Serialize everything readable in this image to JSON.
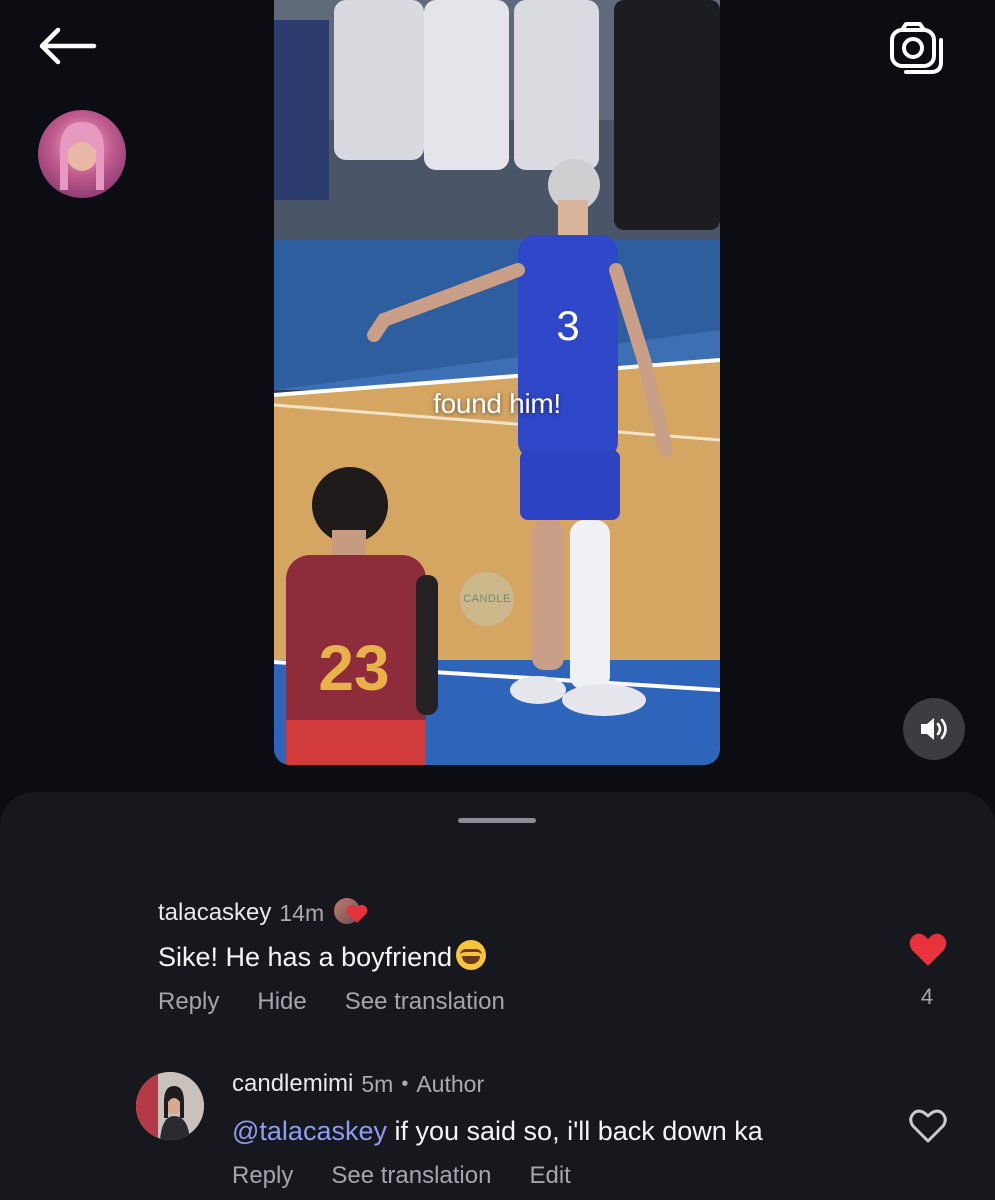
{
  "video": {
    "caption": "found him!",
    "watermark": "CANDLE"
  },
  "icons": {
    "back": "arrow-left-icon",
    "camera": "camera-icon",
    "volume": "volume-icon",
    "like_filled": "heart-filled-icon",
    "like_outline": "heart-outline-icon"
  },
  "colors": {
    "background": "#0b0d12",
    "sheet": "#16181d",
    "like_red": "#e8323c",
    "mention": "#8e9cf2"
  },
  "comments": [
    {
      "username": "talacaskey",
      "time": "14m",
      "text": "Sike! He has a boyfriend",
      "actions": [
        "Reply",
        "Hide",
        "See translation"
      ],
      "likes": "4",
      "liked": true
    },
    {
      "username": "candlemimi",
      "time": "5m",
      "separator": "•",
      "badge": "Author",
      "mention": "@talacaskey",
      "text": " if you said so, i'll back down ka",
      "actions": [
        "Reply",
        "See translation",
        "Edit"
      ],
      "liked": false
    }
  ]
}
